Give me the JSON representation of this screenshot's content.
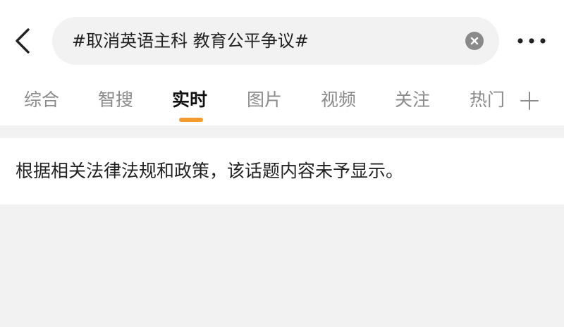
{
  "header": {
    "back_icon": "chevron-left-icon",
    "search_query": "#取消英语主科 教育公平争议#",
    "clear_icon": "close-circle-icon",
    "more_icon": "more-horizontal-icon"
  },
  "tabs": [
    {
      "label": "综合",
      "active": false
    },
    {
      "label": "智搜",
      "active": false
    },
    {
      "label": "实时",
      "active": true
    },
    {
      "label": "图片",
      "active": false
    },
    {
      "label": "视频",
      "active": false
    },
    {
      "label": "关注",
      "active": false
    },
    {
      "label": "热门",
      "active": false
    }
  ],
  "tab_add_icon": "plus-icon",
  "accent_color": "#f39b2f",
  "notice": {
    "text": "根据相关法律法规和政策，该话题内容未予显示。"
  }
}
